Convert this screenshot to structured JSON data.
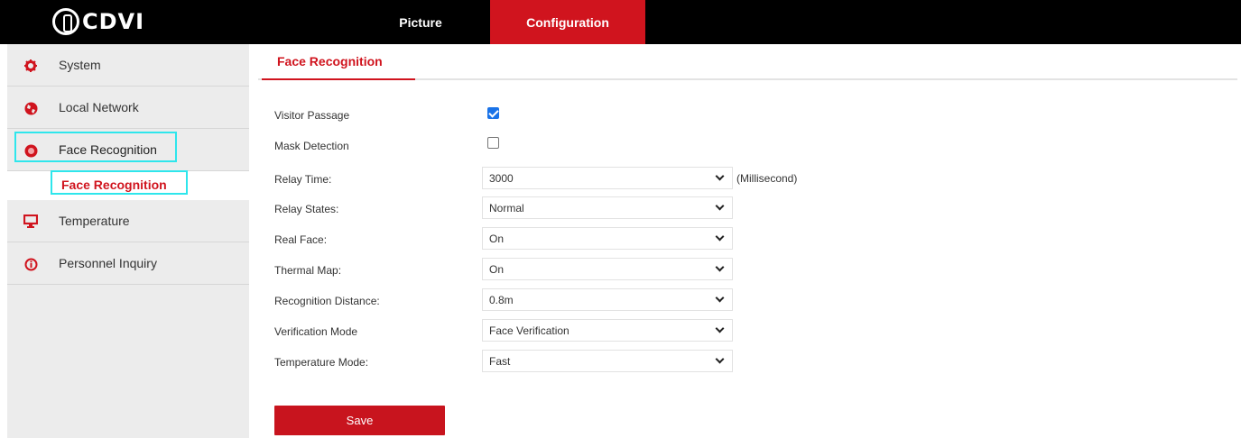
{
  "header": {
    "logo_text": "CDVI",
    "nav": {
      "picture": "Picture",
      "configuration": "Configuration"
    },
    "active_color": "#d0141e"
  },
  "sidebar": {
    "items": [
      {
        "label": "System",
        "icon": "gear-icon"
      },
      {
        "label": "Local Network",
        "icon": "globe-icon"
      },
      {
        "label": "Face Recognition",
        "icon": "face-recognition-icon"
      },
      {
        "label": "Temperature",
        "icon": "monitor-icon"
      },
      {
        "label": "Personnel Inquiry",
        "icon": "info-icon"
      }
    ],
    "sub_item": "Face Recognition"
  },
  "main": {
    "tab": "Face Recognition",
    "form": {
      "visitor_passage": {
        "label": "Visitor Passage",
        "checked": true
      },
      "mask_detection": {
        "label": "Mask Detection",
        "checked": false
      },
      "relay_time": {
        "label": "Relay Time:",
        "value": "3000",
        "unit": "(Millisecond)"
      },
      "relay_states": {
        "label": "Relay States:",
        "value": "Normal"
      },
      "real_face": {
        "label": "Real Face:",
        "value": "On"
      },
      "thermal_map": {
        "label": "Thermal Map:",
        "value": "On"
      },
      "recognition_distance": {
        "label": "Recognition Distance:",
        "value": "0.8m"
      },
      "verification_mode": {
        "label": "Verification Mode",
        "value": "Face Verification"
      },
      "temperature_mode": {
        "label": "Temperature Mode:",
        "value": "Fast"
      }
    },
    "save_label": "Save"
  }
}
